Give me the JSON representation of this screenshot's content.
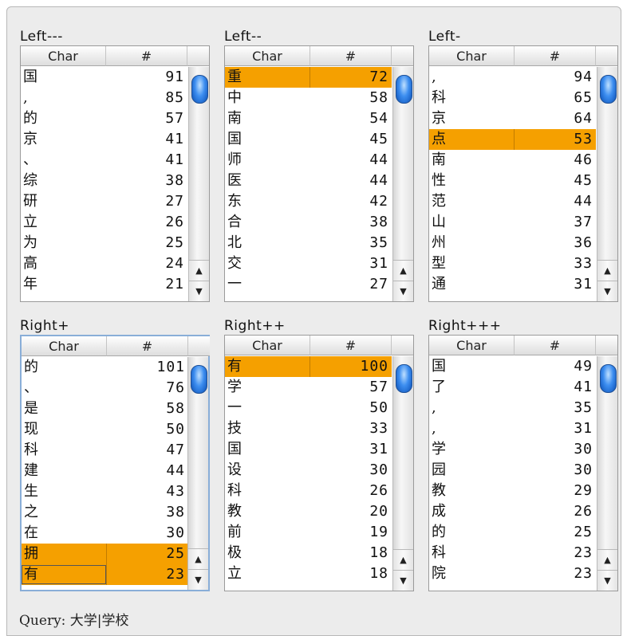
{
  "columns": {
    "char": "Char",
    "count": "#"
  },
  "panels": [
    {
      "title": "Left---",
      "rows": [
        {
          "char": "国",
          "count": "91"
        },
        {
          "char": ",",
          "count": "85"
        },
        {
          "char": "的",
          "count": "57"
        },
        {
          "char": "京",
          "count": "41"
        },
        {
          "char": "、",
          "count": "41"
        },
        {
          "char": "综",
          "count": "38"
        },
        {
          "char": "研",
          "count": "27"
        },
        {
          "char": "立",
          "count": "26"
        },
        {
          "char": "为",
          "count": "25"
        },
        {
          "char": "高",
          "count": "24"
        },
        {
          "char": "年",
          "count": "21"
        }
      ]
    },
    {
      "title": "Left--",
      "rows": [
        {
          "char": "重",
          "count": "72",
          "selected": true
        },
        {
          "char": "中",
          "count": "58"
        },
        {
          "char": "南",
          "count": "54"
        },
        {
          "char": "国",
          "count": "45"
        },
        {
          "char": "师",
          "count": "44"
        },
        {
          "char": "医",
          "count": "44"
        },
        {
          "char": "东",
          "count": "42"
        },
        {
          "char": "合",
          "count": "38"
        },
        {
          "char": "北",
          "count": "35"
        },
        {
          "char": "交",
          "count": "31"
        },
        {
          "char": "一",
          "count": "27"
        }
      ]
    },
    {
      "title": "Left-",
      "rows": [
        {
          "char": ",",
          "count": "94"
        },
        {
          "char": "科",
          "count": "65"
        },
        {
          "char": "京",
          "count": "64"
        },
        {
          "char": "点",
          "count": "53",
          "selected": true
        },
        {
          "char": "南",
          "count": "46"
        },
        {
          "char": "性",
          "count": "45"
        },
        {
          "char": "范",
          "count": "44"
        },
        {
          "char": "山",
          "count": "37"
        },
        {
          "char": "州",
          "count": "36"
        },
        {
          "char": "型",
          "count": "33"
        },
        {
          "char": "通",
          "count": "31"
        }
      ]
    },
    {
      "title": "Right+",
      "focused": true,
      "rows": [
        {
          "char": "的",
          "count": "101"
        },
        {
          "char": "、",
          "count": "76"
        },
        {
          "char": "是",
          "count": "58"
        },
        {
          "char": "现",
          "count": "50"
        },
        {
          "char": "科",
          "count": "47"
        },
        {
          "char": "建",
          "count": "44"
        },
        {
          "char": "生",
          "count": "43"
        },
        {
          "char": "之",
          "count": "38"
        },
        {
          "char": "在",
          "count": "30"
        },
        {
          "char": "拥",
          "count": "25",
          "selected": true
        },
        {
          "char": "有",
          "count": "23",
          "selected": true,
          "boxed": true
        }
      ]
    },
    {
      "title": "Right++",
      "rows": [
        {
          "char": "有",
          "count": "100",
          "selected": true
        },
        {
          "char": "学",
          "count": "57"
        },
        {
          "char": "一",
          "count": "50"
        },
        {
          "char": "技",
          "count": "33"
        },
        {
          "char": "国",
          "count": "31"
        },
        {
          "char": "设",
          "count": "30"
        },
        {
          "char": "科",
          "count": "26"
        },
        {
          "char": "教",
          "count": "20"
        },
        {
          "char": "前",
          "count": "19"
        },
        {
          "char": "极",
          "count": "18"
        },
        {
          "char": "立",
          "count": "18"
        }
      ]
    },
    {
      "title": "Right+++",
      "rows": [
        {
          "char": "国",
          "count": "49"
        },
        {
          "char": "了",
          "count": "41"
        },
        {
          "char": ",",
          "count": "35"
        },
        {
          "char": ",",
          "count": "31"
        },
        {
          "char": "学",
          "count": "30"
        },
        {
          "char": "园",
          "count": "30"
        },
        {
          "char": "教",
          "count": "29"
        },
        {
          "char": "成",
          "count": "26"
        },
        {
          "char": "的",
          "count": "25"
        },
        {
          "char": "科",
          "count": "23"
        },
        {
          "char": "院",
          "count": "23"
        }
      ]
    }
  ],
  "icons": {
    "scroll_up": "▲",
    "scroll_down": "▼"
  },
  "colors": {
    "selection": "#f5a000",
    "focus_ring": "#89aed8",
    "scroll_thumb": "#3d8ef0"
  },
  "query": {
    "text": "Query: 大学|学校"
  }
}
